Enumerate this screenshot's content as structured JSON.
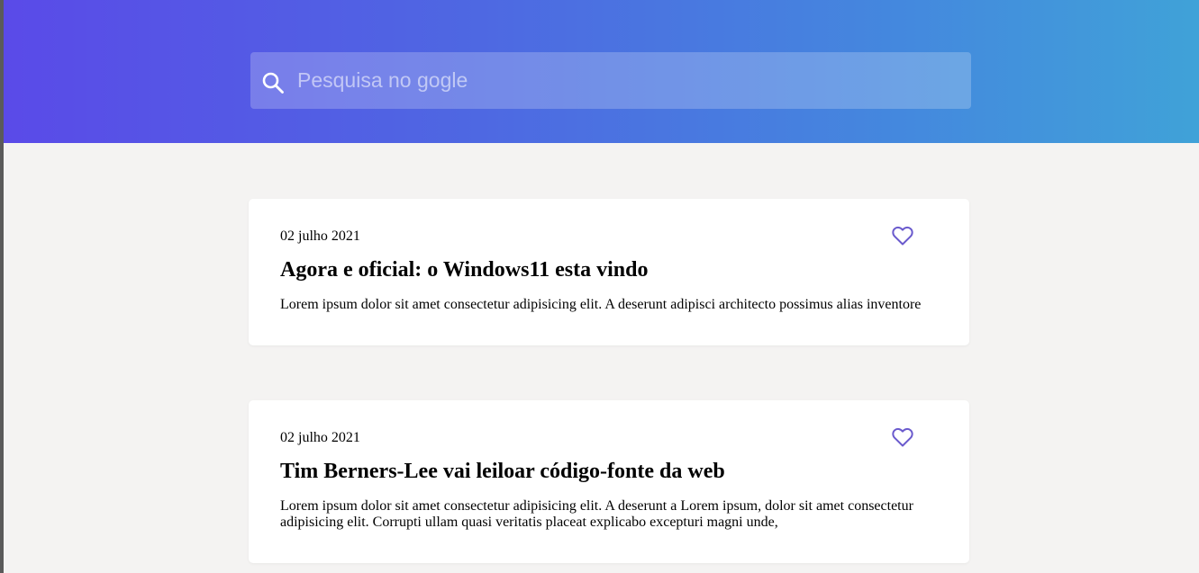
{
  "search": {
    "placeholder": "Pesquisa no gogle",
    "value": ""
  },
  "colors": {
    "header_gradient_start": "#5a4ae8",
    "header_gradient_end": "#40a2d8",
    "heart_accent": "#6a5acd",
    "page_background": "#f4f3f2"
  },
  "icons": {
    "search": "search-icon",
    "favorite": "heart-icon"
  },
  "posts": [
    {
      "date": "02 julho 2021",
      "title": "Agora e oficial: o Windows11 esta vindo",
      "body": "Lorem ipsum dolor sit amet consectetur adipisicing elit. A deserunt adipisci architecto possimus alias inventore"
    },
    {
      "date": "02 julho 2021",
      "title": "Tim Berners-Lee vai leiloar código-fonte da web",
      "body": "Lorem ipsum dolor sit amet consectetur adipisicing elit. A deserunt a Lorem ipsum, dolor sit amet consectetur adipisicing elit. Corrupti ullam quasi veritatis placeat explicabo excepturi magni unde,"
    }
  ]
}
